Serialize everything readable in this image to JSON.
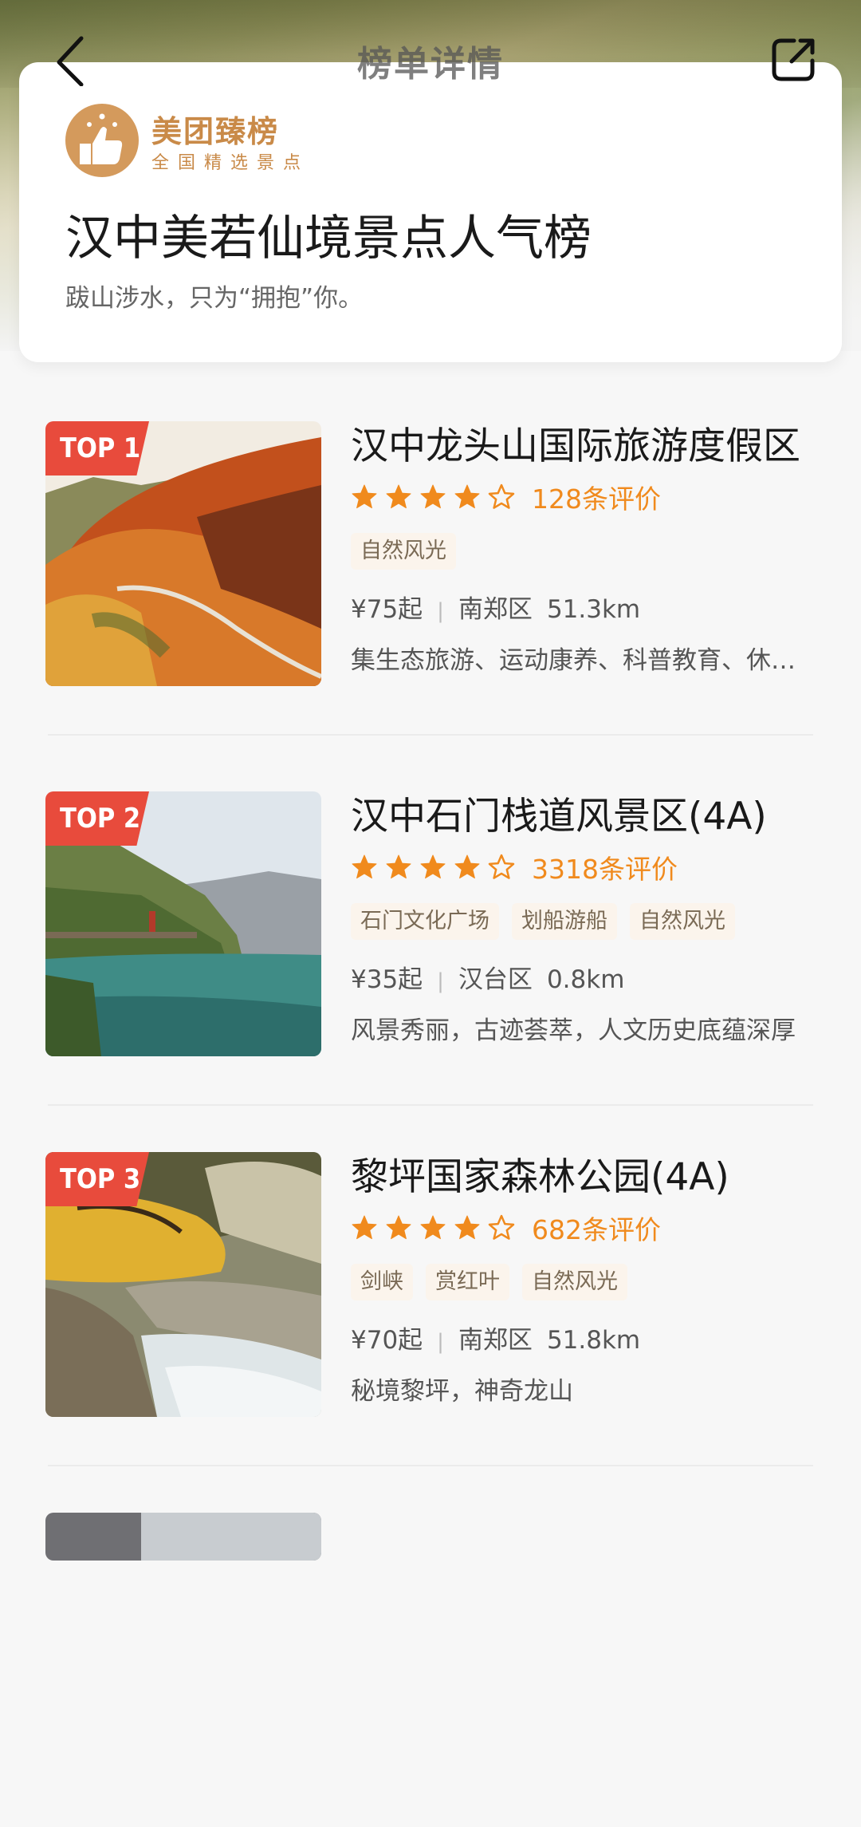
{
  "nav": {
    "title": "榜单详情"
  },
  "brand": {
    "name": "美团臻榜",
    "sub": "全国精选景点"
  },
  "list": {
    "title": "汉中美若仙境景点人气榜",
    "subtitle": "跋山涉水，只为“拥抱”你。"
  },
  "colors": {
    "accent": "#f08a1d",
    "badge": "#e84b3c",
    "brand": "#c98a48"
  },
  "items": [
    {
      "rank": "TOP 1",
      "name": "汉中龙头山国际旅游度假区",
      "rating": 4,
      "reviews": "128条评价",
      "tags": [
        "自然风光"
      ],
      "price": "¥75起",
      "district": "南郑区",
      "distance": "51.3km",
      "desc": "集生态旅游、运动康养、科普教育、休闲度假于一体"
    },
    {
      "rank": "TOP 2",
      "name": "汉中石门栈道风景区(4A)",
      "rating": 4,
      "reviews": "3318条评价",
      "tags": [
        "石门文化广场",
        "划船游船",
        "自然风光"
      ],
      "price": "¥35起",
      "district": "汉台区",
      "distance": "0.8km",
      "desc": "风景秀丽，古迹荟萃，人文历史底蕴深厚"
    },
    {
      "rank": "TOP 3",
      "name": "黎坪国家森林公园(4A)",
      "rating": 4,
      "reviews": "682条评价",
      "tags": [
        "剑峡",
        "赏红叶",
        "自然风光"
      ],
      "price": "¥70起",
      "district": "南郑区",
      "distance": "51.8km",
      "desc": "秘境黎坪，神奇龙山"
    }
  ]
}
